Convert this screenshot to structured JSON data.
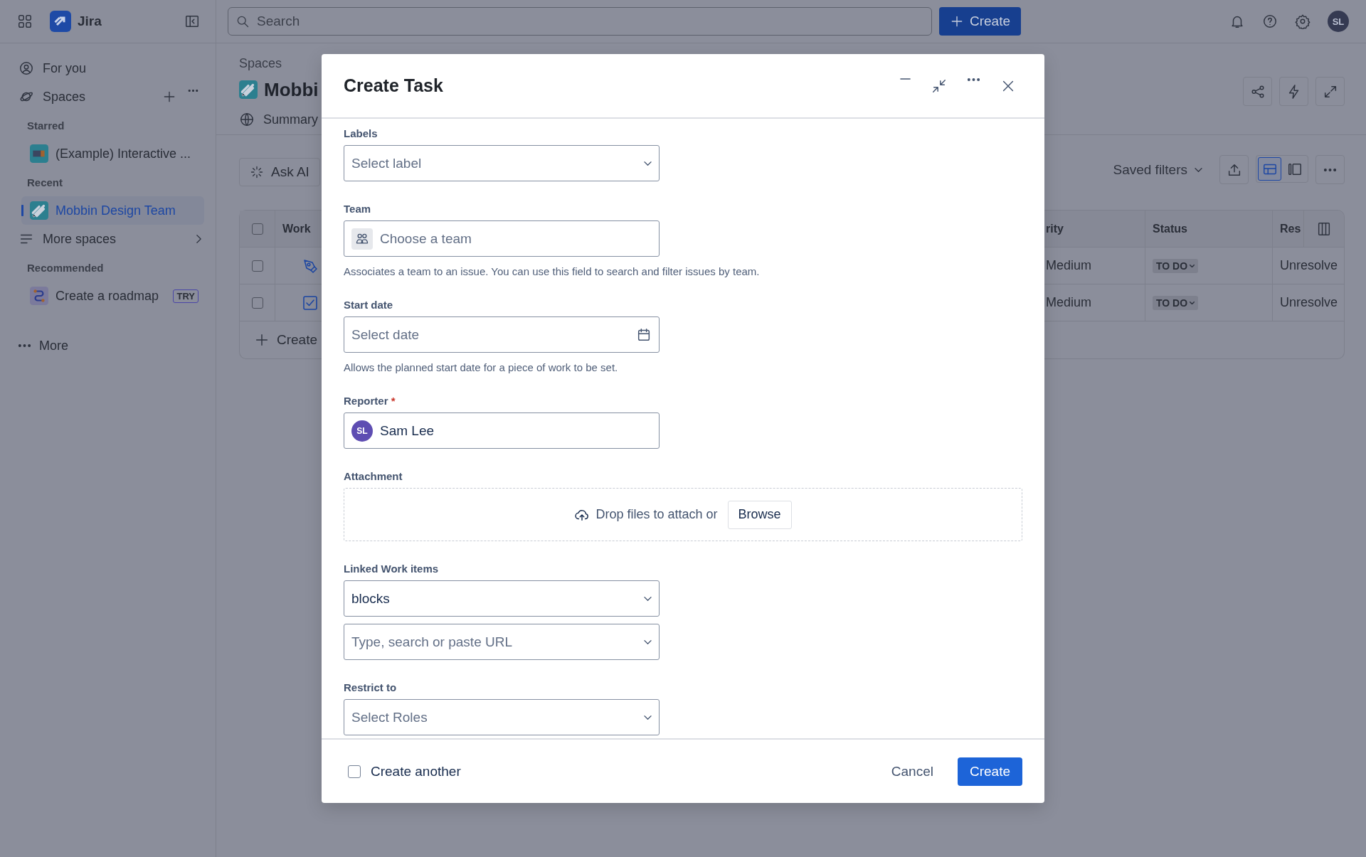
{
  "top_bar": {
    "product": "Jira",
    "search": {
      "placeholder": "Search"
    },
    "create_button": "Create",
    "avatar": "SL"
  },
  "sidebar": {
    "items": [
      {
        "kind": "nav",
        "label": "For you",
        "selected": false
      },
      {
        "kind": "section",
        "label": "Spaces",
        "selected": false
      },
      {
        "kind": "heading",
        "label": "Starred"
      },
      {
        "kind": "space",
        "label": "(Example) Interactive ...",
        "selected": false
      },
      {
        "kind": "heading",
        "label": "Recent"
      },
      {
        "kind": "space",
        "label": "Mobbin Design Team",
        "selected": true
      },
      {
        "kind": "more",
        "label": "More spaces",
        "selected": false
      },
      {
        "kind": "heading",
        "label": "Recommended"
      },
      {
        "kind": "space",
        "label": "Create a roadmap",
        "badge": "TRY",
        "selected": false
      },
      {
        "kind": "nav",
        "label": "More",
        "selected": false
      }
    ]
  },
  "page": {
    "breadcrumb": "Spaces",
    "title": "Mobbi",
    "tab": "Summary",
    "ask_ai": "Ask AI",
    "saved_filters": "Saved filters",
    "views": [
      {
        "kind": "table",
        "selected": true
      },
      {
        "kind": "panel",
        "selected": false
      }
    ],
    "table": {
      "header_checked": false,
      "left_column": "Work",
      "right_columns": [
        "rity",
        "Status",
        "Res"
      ],
      "rows": [
        {
          "checked": false,
          "kind": "design",
          "priority": "Medium",
          "status": "TO DO",
          "resolution": "Unresolve"
        },
        {
          "checked": false,
          "kind": "task",
          "priority": "Medium",
          "status": "TO DO",
          "resolution": "Unresolve"
        }
      ],
      "create_row": "Create"
    }
  },
  "modal": {
    "title": "Create Task",
    "fields": [
      {
        "kind": "select",
        "label": "Labels",
        "placeholder": "Select label"
      },
      {
        "kind": "team",
        "label": "Team",
        "placeholder": "Choose a team",
        "help": "Associates a team to an issue. You can use this field to search and filter issues by team."
      },
      {
        "kind": "date",
        "label": "Start date",
        "placeholder": "Select date",
        "help": "Allows the planned start date for a piece of work to be set."
      },
      {
        "kind": "user",
        "label": "Reporter",
        "required_mark": "*",
        "initials": "SL",
        "value": "Sam Lee"
      },
      {
        "kind": "attachment",
        "label": "Attachment",
        "prompt": "Drop files to attach or",
        "button": "Browse"
      },
      {
        "kind": "linked",
        "label": "Linked Work items",
        "value": "blocks",
        "placeholder": "Type, search or paste URL"
      },
      {
        "kind": "select",
        "label": "Restrict to",
        "placeholder": "Select Roles"
      }
    ],
    "create_another": {
      "label": "Create another",
      "checked": false
    },
    "cancel": "Cancel",
    "submit": "Create"
  }
}
